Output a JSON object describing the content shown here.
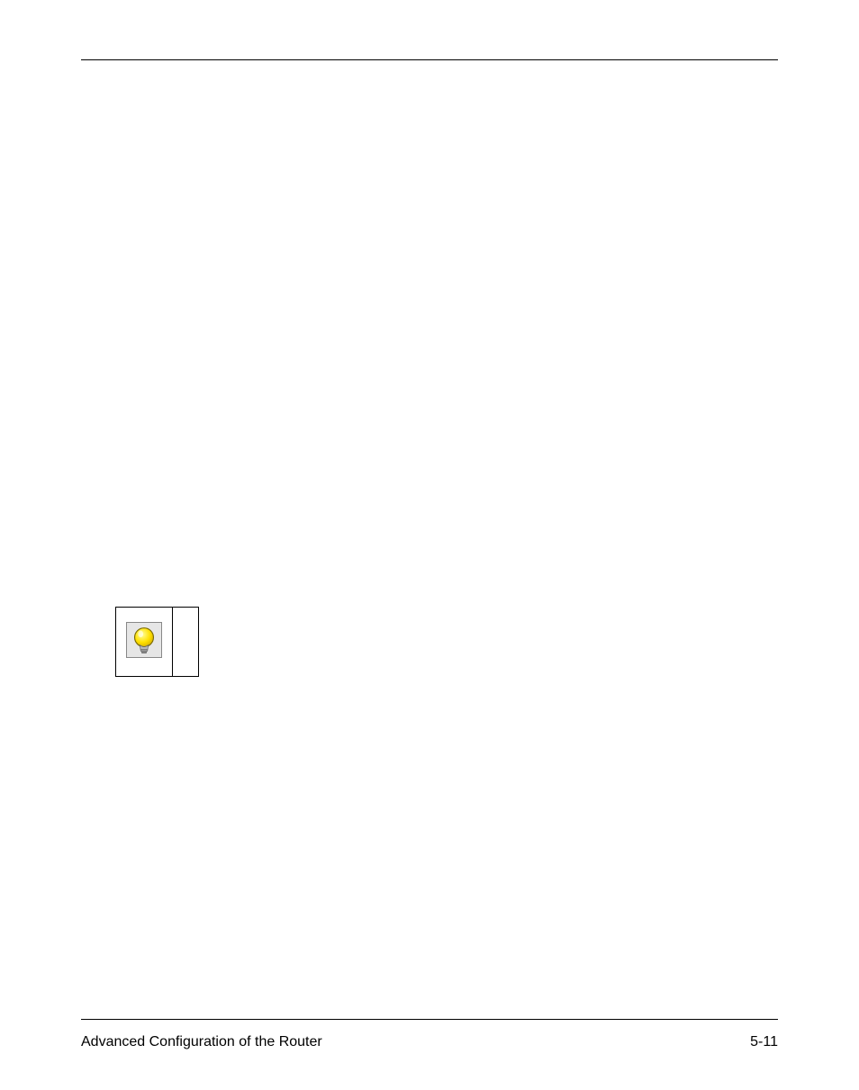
{
  "footer": {
    "left": "Advanced Configuration of the Router",
    "right": "5-11"
  },
  "tip": {
    "icon_name": "lightbulb-icon",
    "text": ""
  }
}
